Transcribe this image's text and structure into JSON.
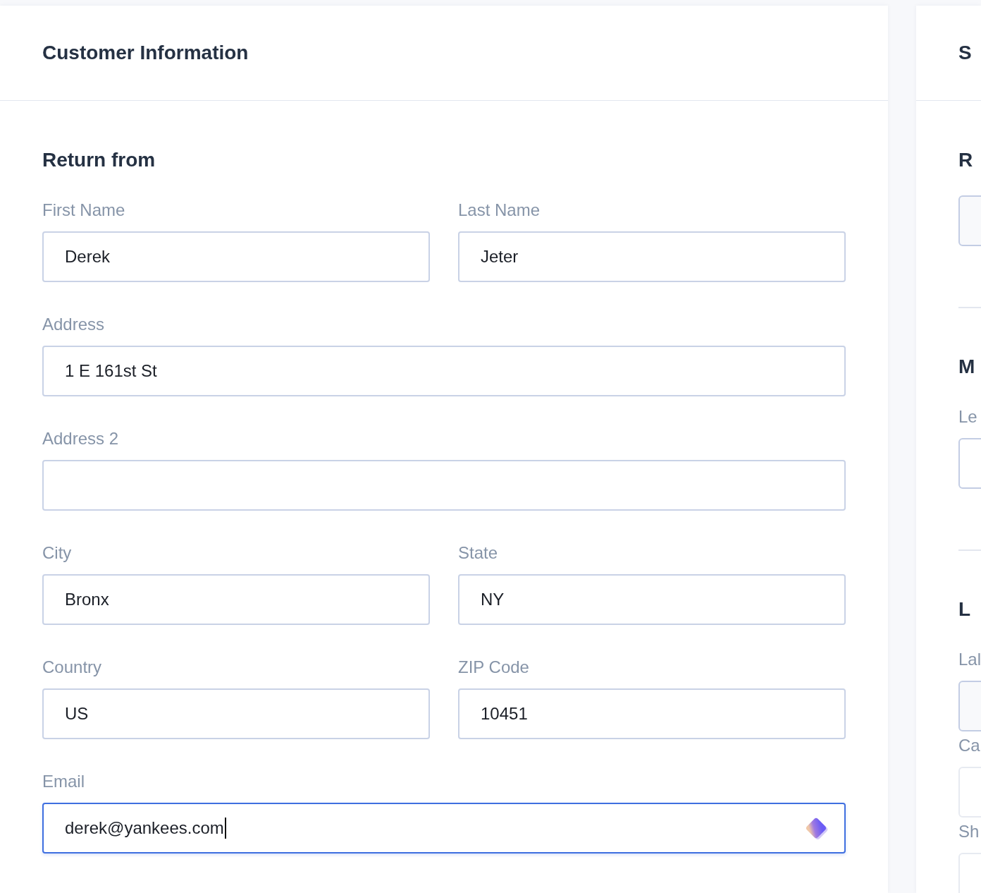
{
  "customer_card": {
    "title": "Customer Information",
    "section_title": "Return from",
    "fields": [
      {
        "label": "First Name",
        "value": "Derek",
        "kind": "half",
        "focused": false
      },
      {
        "label": "Last Name",
        "value": "Jeter",
        "kind": "half",
        "focused": false
      },
      {
        "label": "Address",
        "value": "1 E 161st St",
        "kind": "full",
        "focused": false
      },
      {
        "label": "Address 2",
        "kind": "full",
        "focused": false
      },
      {
        "label": "City",
        "value": "Bronx",
        "kind": "half",
        "focused": false
      },
      {
        "label": "State",
        "value": "NY",
        "kind": "half",
        "focused": false
      },
      {
        "label": "Country",
        "value": "US",
        "kind": "half",
        "focused": false
      },
      {
        "label": "ZIP Code",
        "value": "10451",
        "kind": "half",
        "focused": false
      },
      {
        "label": "Email",
        "value": "derek@yankees.com",
        "kind": "full",
        "focused": true
      }
    ]
  },
  "side_card": {
    "title": "S",
    "sections": [
      {
        "title": "R",
        "fields": [
          {
            "kind": "shaded"
          }
        ]
      },
      {
        "title": "M",
        "fields": [
          {
            "label": "Le",
            "kind": "plain"
          }
        ]
      },
      {
        "title": "L",
        "fields": [
          {
            "label": "Lal",
            "kind": "shaded"
          },
          {
            "label": "Ca",
            "kind": "faint"
          },
          {
            "label": "Sh",
            "kind": "faint"
          }
        ]
      }
    ]
  }
}
